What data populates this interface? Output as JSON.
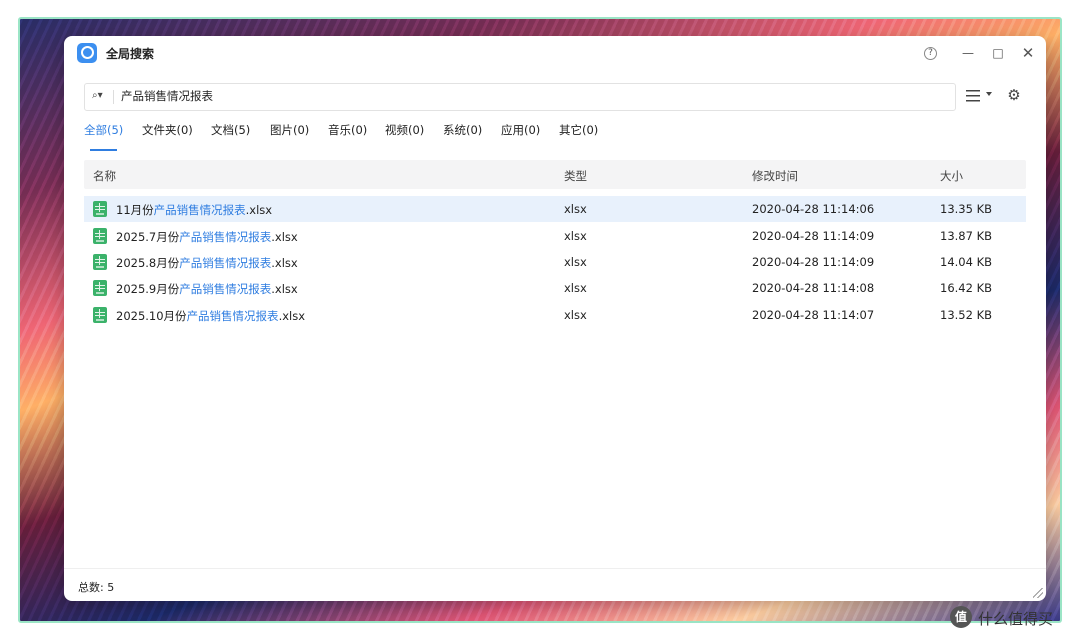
{
  "window": {
    "title": "全局搜索",
    "help_icon": "question-circle-icon",
    "help_glyph": "?",
    "minimize_glyph": "—",
    "maximize_glyph": "□",
    "close_glyph": "✕"
  },
  "search": {
    "icon_glyph": "⌕▾",
    "value": "产品销售情况报表"
  },
  "toolbar": {
    "view_icon": "list-view-icon",
    "settings_icon": "gear-icon",
    "settings_glyph": "⚙"
  },
  "tabs": [
    {
      "label": "全部(5)",
      "active": true
    },
    {
      "label": "文件夹(0)"
    },
    {
      "label": "文档(5)"
    },
    {
      "label": "图片(0)"
    },
    {
      "label": "音乐(0)"
    },
    {
      "label": "视频(0)"
    },
    {
      "label": "系统(0)"
    },
    {
      "label": "应用(0)"
    },
    {
      "label": "其它(0)"
    }
  ],
  "table": {
    "columns": [
      "名称",
      "类型",
      "修改时间",
      "大小"
    ],
    "rows": [
      {
        "prefix": "11月份",
        "match": "产品销售情况报表",
        "suffix": ".xlsx",
        "type": "xlsx",
        "modified": "2020-04-28 11:14:06",
        "size": "13.35 KB",
        "selected": true
      },
      {
        "prefix": "2025.7月份",
        "match": "产品销售情况报表",
        "suffix": ".xlsx",
        "type": "xlsx",
        "modified": "2020-04-28 11:14:09",
        "size": "13.87 KB"
      },
      {
        "prefix": "2025.8月份",
        "match": "产品销售情况报表",
        "suffix": ".xlsx",
        "type": "xlsx",
        "modified": "2020-04-28 11:14:09",
        "size": "14.04 KB"
      },
      {
        "prefix": "2025.9月份",
        "match": "产品销售情况报表",
        "suffix": ".xlsx",
        "type": "xlsx",
        "modified": "2020-04-28 11:14:08",
        "size": "16.42 KB"
      },
      {
        "prefix": "2025.10月份",
        "match": "产品销售情况报表",
        "suffix": ".xlsx",
        "type": "xlsx",
        "modified": "2020-04-28 11:14:07",
        "size": "13.52 KB"
      }
    ]
  },
  "footer": {
    "total": "总数: 5"
  },
  "watermark": {
    "badge": "值",
    "text": "什么值得买"
  },
  "colors": {
    "accent": "#2f7de0",
    "selected_row": "#e8f1fc",
    "excel_green": "#3bb26a"
  }
}
